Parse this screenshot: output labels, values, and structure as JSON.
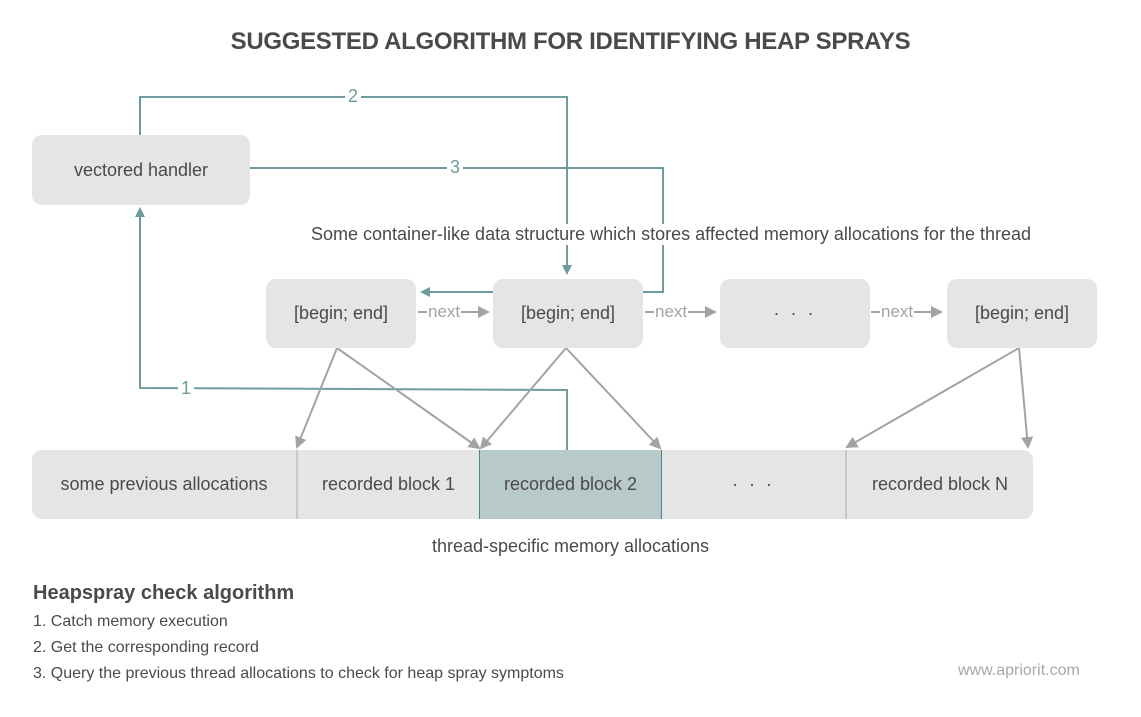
{
  "title": "SUGGESTED ALGORITHM FOR IDENTIFYING HEAP SPRAYS",
  "vectored_handler": "vectored handler",
  "container_label": "Some container-like data structure which stores affected memory allocations for the thread",
  "nodes": [
    {
      "label": "[begin; end]"
    },
    {
      "label": "[begin; end]"
    },
    {
      "label": "· · ·"
    },
    {
      "label": "[begin; end]"
    }
  ],
  "next_label": "next",
  "arrow_labels": {
    "step1": "1",
    "step2": "2",
    "step3": "3"
  },
  "memory_segments": [
    {
      "label": "some previous allocations",
      "highlighted": false
    },
    {
      "label": "recorded block 1",
      "highlighted": false
    },
    {
      "label": "recorded block 2",
      "highlighted": true
    },
    {
      "label": "· · ·",
      "highlighted": false
    },
    {
      "label": "recorded block N",
      "highlighted": false
    }
  ],
  "memory_label": "thread-specific memory allocations",
  "algorithm": {
    "title": "Heapspray check algorithm",
    "steps": [
      "1.  Catch memory execution",
      "2. Get the corresponding record",
      "3. Query the previous thread allocations to check for heap spray symptoms"
    ]
  },
  "website": "www.apriorit.com",
  "colors": {
    "teal": "#6e9c9e",
    "box_gray": "#e5e5e5",
    "highlight": "#b8c9c9",
    "arrow_gray": "#a3a3a3",
    "text": "#4a4a4a"
  }
}
